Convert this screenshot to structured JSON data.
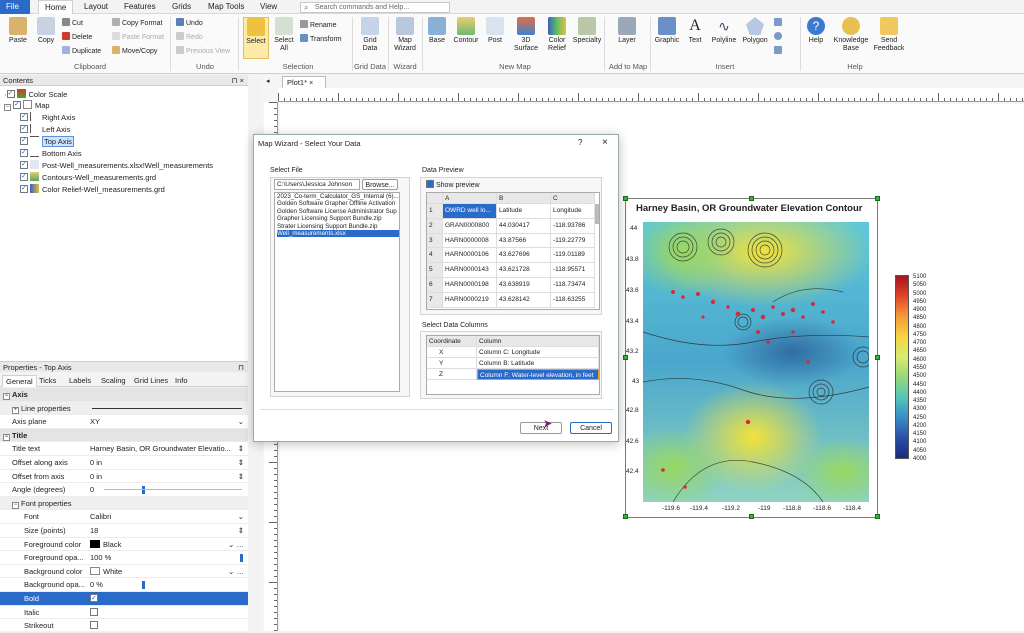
{
  "menu": {
    "tabs": [
      "File",
      "Home",
      "Layout",
      "Features",
      "Grids",
      "Map Tools",
      "View"
    ],
    "active": "Home",
    "search_placeholder": "Search commands and Help..."
  },
  "ribbon": {
    "clipboard": {
      "label": "Clipboard",
      "paste": "Paste",
      "copy": "Copy",
      "cut": "Cut",
      "delete": "Delete",
      "duplicate": "Duplicate",
      "copy_format": "Copy Format",
      "paste_format": "Paste Format",
      "move_copy": "Move/Copy"
    },
    "undo": {
      "label": "Undo",
      "undo": "Undo",
      "redo": "Redo",
      "previous_view": "Previous View"
    },
    "selection": {
      "label": "Selection",
      "select": "Select",
      "select_all": "Select All",
      "rename": "Rename",
      "transform": "Transform"
    },
    "grid_data": {
      "label": "Grid Data",
      "btn": "Grid Data"
    },
    "wizard": {
      "label": "Wizard",
      "btn": "Map Wizard"
    },
    "new_map": {
      "label": "New Map",
      "base": "Base",
      "contour": "Contour",
      "post": "Post",
      "surface": "3D Surface",
      "color_relief": "Color Relief",
      "specialty": "Specialty"
    },
    "add_to_map": {
      "label": "Add to Map",
      "layer": "Layer"
    },
    "insert": {
      "label": "Insert",
      "graphic": "Graphic",
      "text": "Text",
      "polyline": "Polyline",
      "polygon": "Polygon"
    },
    "help": {
      "label": "Help",
      "help": "Help",
      "kb": "Knowledge Base",
      "feedback": "Send Feedback"
    }
  },
  "contents": {
    "title": "Contents",
    "items": [
      "Color Scale",
      "Map",
      "Right Axis",
      "Left Axis",
      "Top Axis",
      "Bottom Axis",
      "Post-Well_measurements.xlsx!Well_measurements",
      "Contours-Well_measurements.grd",
      "Color Relief-Well_measurements.grd"
    ]
  },
  "properties": {
    "title": "Properties - Top Axis",
    "tabs": [
      "General",
      "Ticks",
      "Labels",
      "Scaling",
      "Grid Lines",
      "Info"
    ],
    "axis_section": "Axis",
    "line_properties": "Line properties",
    "axis_plane_k": "Axis plane",
    "axis_plane_v": "XY",
    "title_section": "Title",
    "title_text_k": "Title text",
    "title_text_v": "Harney Basin, OR Groundwater Elevatio...",
    "offset_along_k": "Offset along axis",
    "offset_along_v": "0 in",
    "offset_from_k": "Offset from axis",
    "offset_from_v": "0 in",
    "angle_k": "Angle (degrees)",
    "angle_v": "0",
    "font_props": "Font properties",
    "font_k": "Font",
    "font_v": "Calibri",
    "size_k": "Size (points)",
    "size_v": "18",
    "fg_color_k": "Foreground color",
    "fg_color_v": "Black",
    "fg_opa_k": "Foreground opa...",
    "fg_opa_v": "100 %",
    "bg_color_k": "Background color",
    "bg_color_v": "White",
    "bg_opa_k": "Background opa...",
    "bg_opa_v": "0 %",
    "bold_k": "Bold",
    "italic_k": "Italic",
    "strikeout_k": "Strikeout"
  },
  "plot_tab": "Plot1*",
  "dialog": {
    "title": "Map Wizard - Select Your Data",
    "select_file": "Select File",
    "path": "C:\\Users\\Jessica Johnson",
    "browse": "Browse...",
    "files": [
      "2023_Co-term_Calculator_GS_Internal (6)...",
      "Golden Software Grapher Offline Activation",
      "Golden Software License Administrator Sup",
      "Grapher Licensing Support Bundle.zip",
      "Strater Licensing Support Bundle.zip",
      "Well_measurements.xlsx"
    ],
    "data_preview": "Data Preview",
    "show_preview": "Show preview",
    "col_headers": [
      "A",
      "B",
      "C"
    ],
    "rows": [
      [
        "1",
        "OWRD well lo...",
        "Latitude",
        "Longitude"
      ],
      [
        "2",
        "GRAN0000800",
        "44.030417",
        "-118.93786"
      ],
      [
        "3",
        "HARN0000008",
        "43.87566",
        "-119.22779"
      ],
      [
        "4",
        "HARN0000106",
        "43.627696",
        "-119.01189"
      ],
      [
        "5",
        "HARN0000143",
        "43.621728",
        "-118.95571"
      ],
      [
        "6",
        "HARN0000198",
        "43.638919",
        "-118.73474"
      ],
      [
        "7",
        "HARN0000219",
        "43.628142",
        "-118.63255"
      ]
    ],
    "select_columns": "Select Data Columns",
    "coord_hdr": "Coordinate",
    "column_hdr": "Column",
    "coords": [
      {
        "c": "X",
        "v": "Column C:  Longitude"
      },
      {
        "c": "Y",
        "v": "Column B:  Latitude"
      },
      {
        "c": "Z",
        "v": "Column F:  Water-level elevation, in feet"
      }
    ],
    "next": "Next",
    "cancel": "Cancel"
  },
  "map": {
    "title": "Harney Basin, OR Groundwater Elevation Contour",
    "x_ticks": [
      "-119.6",
      "-119.4",
      "-119.2",
      "-119",
      "-118.8",
      "-118.6",
      "-118.4"
    ],
    "y_ticks": [
      "44",
      "43.8",
      "43.6",
      "43.4",
      "43.2",
      "43",
      "42.8",
      "42.6",
      "42.4"
    ],
    "colorbar": [
      "5100",
      "5050",
      "5000",
      "4950",
      "4900",
      "4850",
      "4800",
      "4750",
      "4700",
      "4650",
      "4600",
      "4550",
      "4500",
      "4450",
      "4400",
      "4350",
      "4300",
      "4250",
      "4200",
      "4150",
      "4100",
      "4050",
      "4000"
    ]
  }
}
